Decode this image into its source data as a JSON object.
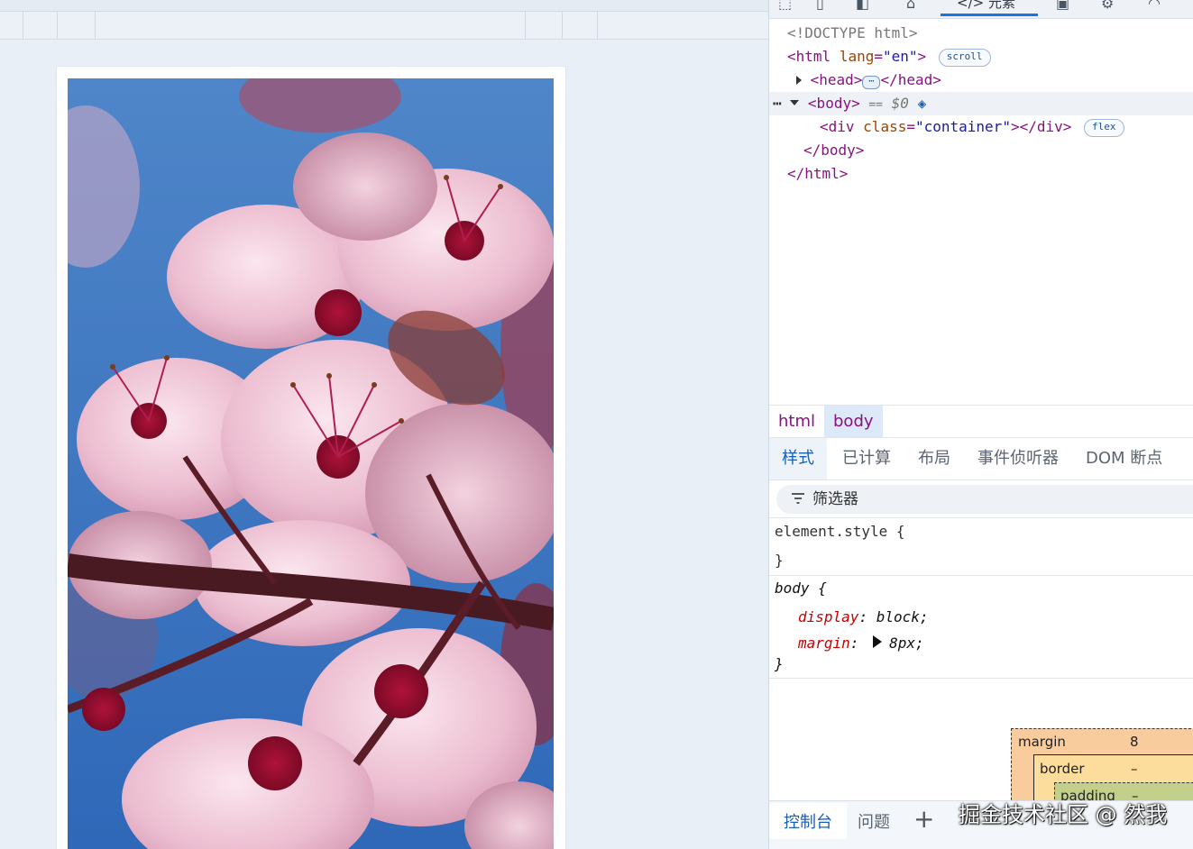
{
  "devtools": {
    "active_panel_label": "元素",
    "dom": {
      "doctype": "<!DOCTYPE html>",
      "html_open_tag": "<html",
      "html_attr_name": "lang",
      "html_attr_value": "\"en\"",
      "html_close_bracket": ">",
      "html_badge": "scroll",
      "head_open": "<head>",
      "head_ellipsis": "⋯",
      "head_close": "</head>",
      "body_open": "<body>",
      "body_eq": "==",
      "body_ref": "$0",
      "row_menu": "⋯",
      "div_open": "<div",
      "div_attr_name": "class",
      "div_attr_value": "\"container\"",
      "div_close": "></div>",
      "div_badge": "flex",
      "body_close": "</body>",
      "html_close": "</html>"
    },
    "breadcrumb": [
      "html",
      "body"
    ],
    "style_tabs": [
      "样式",
      "已计算",
      "布局",
      "事件侦听器",
      "DOM 断点"
    ],
    "filter_placeholder": "筛选器",
    "rules": {
      "element_style_open": "element.style {",
      "element_style_close": "}",
      "body_selector": "body {",
      "decl1_prop": "display",
      "decl1_val": "block;",
      "decl2_prop": "margin",
      "decl2_val": "8px;",
      "body_close": "}"
    },
    "box_model": {
      "margin_label": "margin",
      "margin_value": "8",
      "border_label": "border",
      "border_value": "–",
      "padding_label": "padding",
      "padding_value": "–"
    },
    "drawer": {
      "console_tab": "控制台",
      "issues_tab": "问题",
      "add_symbol": "+"
    }
  },
  "watermark": "掘金技术社区 @ 然我",
  "page": {
    "image_subject": "cherry-blossom-photo"
  }
}
